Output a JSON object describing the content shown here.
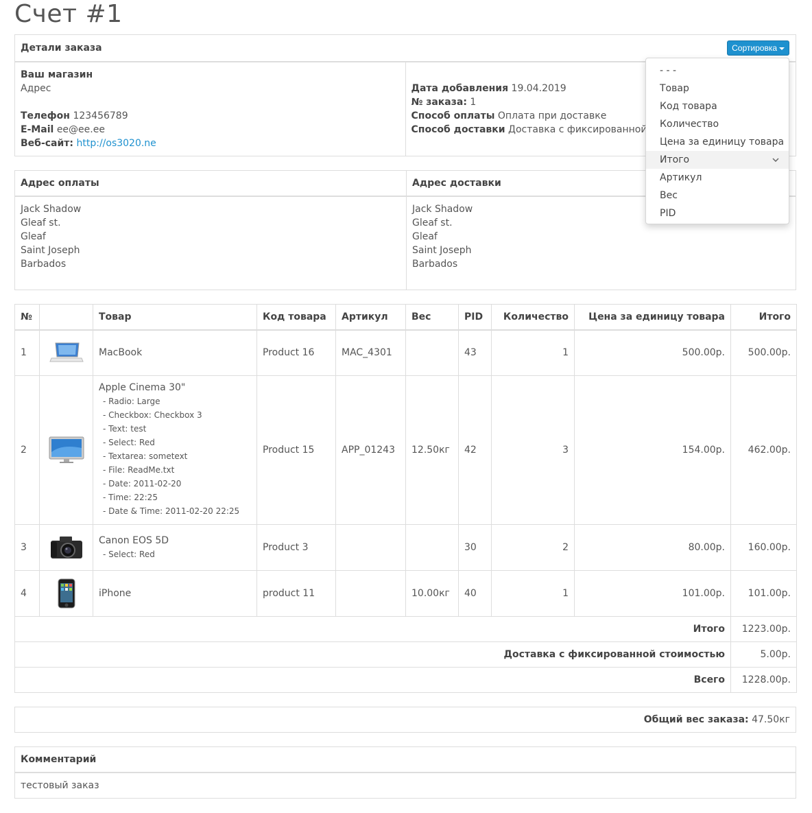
{
  "title": "Счет #1",
  "details": {
    "header": "Детали заказа",
    "sort_label": "Сортировка",
    "store_name": "Ваш магазин",
    "address": "Адрес",
    "phone_label": "Телефон",
    "phone": "123456789",
    "email_label": "E-Mail",
    "email": "ee@ee.ee",
    "website_label": "Веб-сайт:",
    "website": "http://os3020.ne",
    "date_label": "Дата добавления",
    "date": "19.04.2019",
    "order_no_label": "№ заказа:",
    "order_no": "1",
    "payment_label": "Способ оплаты",
    "payment": "Оплата при доставке",
    "shipping_label": "Способ доставки",
    "shipping": "Доставка с фиксированной сто"
  },
  "addresses": {
    "payment_header": "Адрес оплаты",
    "shipping_header": "Адрес доставки",
    "payment_lines": [
      "Jack Shadow",
      "Gleaf st.",
      "Gleaf",
      "Saint Joseph",
      "Barbados"
    ],
    "shipping_lines": [
      "Jack Shadow",
      "Gleaf st.",
      "Gleaf",
      "Saint Joseph",
      "Barbados"
    ]
  },
  "products": {
    "headers": [
      "№",
      "",
      "Товар",
      "Код товара",
      "Артикул",
      "Вес",
      "PID",
      "Количество",
      "Цена за единицу товара",
      "Итого"
    ],
    "rows": [
      {
        "no": "1",
        "name": "MacBook",
        "options": [],
        "code": "Product 16",
        "sku": "MAC_4301",
        "weight": "",
        "pid": "43",
        "qty": "1",
        "price": "500.00р.",
        "total": "500.00р."
      },
      {
        "no": "2",
        "name": "Apple Cinema 30\"",
        "options": [
          "- Radio: Large",
          "- Checkbox: Checkbox 3",
          "- Text: test",
          "- Select: Red",
          "- Textarea: sometext",
          "- File: ReadMe.txt",
          "- Date: 2011-02-20",
          "- Time: 22:25",
          "- Date & Time: 2011-02-20 22:25"
        ],
        "code": "Product 15",
        "sku": "APP_01243",
        "weight": "12.50кг",
        "pid": "42",
        "qty": "3",
        "price": "154.00р.",
        "total": "462.00р."
      },
      {
        "no": "3",
        "name": "Canon EOS 5D",
        "options": [
          "- Select: Red"
        ],
        "code": "Product 3",
        "sku": "",
        "weight": "",
        "pid": "30",
        "qty": "2",
        "price": "80.00р.",
        "total": "160.00р."
      },
      {
        "no": "4",
        "name": "iPhone",
        "options": [],
        "code": "product 11",
        "sku": "",
        "weight": "10.00кг",
        "pid": "40",
        "qty": "1",
        "price": "101.00р.",
        "total": "101.00р."
      }
    ],
    "totals": [
      {
        "label": "Итого",
        "value": "1223.00р."
      },
      {
        "label": "Доставка с фиксированной стоимостью",
        "value": "5.00р."
      },
      {
        "label": "Всего",
        "value": "1228.00р."
      }
    ]
  },
  "weight": {
    "label": "Общий вес заказа:",
    "value": "47.50кг"
  },
  "comment": {
    "header": "Комментарий",
    "text": "тестовый заказ"
  },
  "sort_menu": {
    "items": [
      "- - -",
      "Товар",
      "Код товара",
      "Количество",
      "Цена за единицу товара",
      "Итого",
      "Артикул",
      "Вес",
      "PID"
    ],
    "active": "Итого"
  }
}
